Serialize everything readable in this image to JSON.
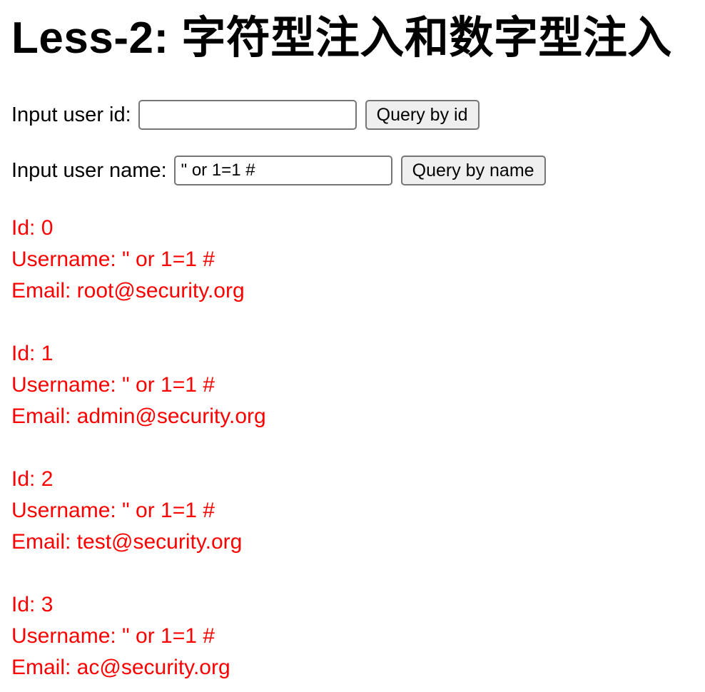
{
  "page": {
    "title": "Less-2: 字符型注入和数字型注入"
  },
  "id_form": {
    "label": "Input user id:",
    "value": "",
    "button_label": "Query by id"
  },
  "name_form": {
    "label": "Input user name:",
    "value": "\" or 1=1 #",
    "button_label": "Query by name"
  },
  "colors": {
    "result_text": "#ff0000"
  },
  "results": [
    {
      "id_text": "Id: 0",
      "username_text": "Username: \" or 1=1 #",
      "email_text": "Email: root@security.org"
    },
    {
      "id_text": "Id: 1",
      "username_text": "Username: \" or 1=1 #",
      "email_text": "Email: admin@security.org"
    },
    {
      "id_text": "Id: 2",
      "username_text": "Username: \" or 1=1 #",
      "email_text": "Email: test@security.org"
    },
    {
      "id_text": "Id: 3",
      "username_text": "Username: \" or 1=1 #",
      "email_text": "Email: ac@security.org"
    }
  ]
}
